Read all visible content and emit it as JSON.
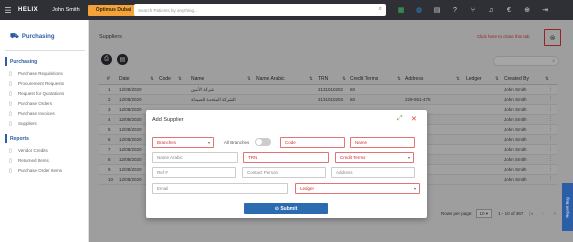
{
  "topbar": {
    "logo": "HELIX",
    "user_name": "John Smith",
    "company": "Optimus Dubai",
    "search_placeholder": "Search Patients by anything..."
  },
  "sidebar": {
    "title": "Purchasing",
    "items": [
      {
        "label": "Purchasing",
        "icon": "cart-icon",
        "section": true
      },
      {
        "label": "Purchase Requisitions",
        "icon": "doc-icon"
      },
      {
        "label": "Procurement Requests",
        "icon": "doc-icon"
      },
      {
        "label": "Request for Quotations",
        "icon": "doc-icon"
      },
      {
        "label": "Purchase Orders",
        "icon": "doc-icon"
      },
      {
        "label": "Purchase Invoices",
        "icon": "doc-icon"
      },
      {
        "label": "Suppliers",
        "icon": "doc-icon"
      },
      {
        "label": "Reports",
        "icon": "report-icon",
        "section": true
      },
      {
        "label": "Vendor Credits",
        "icon": "doc-icon"
      },
      {
        "label": "Returned Items",
        "icon": "doc-icon"
      },
      {
        "label": "Purchase Order Items",
        "icon": "doc-icon"
      }
    ]
  },
  "page": {
    "title": "Suppliers",
    "close_tip": "Click here to close this tab"
  },
  "table": {
    "columns": [
      "#",
      "Date",
      "Code",
      "Name",
      "Name Arabic",
      "TRN",
      "Credit Terms",
      "Address",
      "Ledger",
      "Created By"
    ],
    "rows": [
      {
        "n": "1",
        "date": "12/08/2020",
        "code": "",
        "name": "شركة الأمين",
        "name_ar": "",
        "trn": "2131010202",
        "terms": "60",
        "address": "",
        "ledger": "",
        "by": "John Smith"
      },
      {
        "n": "2",
        "date": "12/08/2020",
        "code": "",
        "name": "الشركة المتحدة للصيدلة",
        "name_ar": "",
        "trn": "2131010203",
        "terms": "60",
        "address": "229-551-475",
        "ledger": "",
        "by": "John Smith"
      },
      {
        "n": "3",
        "date": "12/08/2020",
        "code": "",
        "name": "",
        "name_ar": "",
        "trn": "",
        "terms": "",
        "address": "",
        "ledger": "",
        "by": "John Smith"
      },
      {
        "n": "4",
        "date": "12/08/2020",
        "code": "",
        "name": "",
        "name_ar": "",
        "trn": "",
        "terms": "",
        "address": "",
        "ledger": "",
        "by": "John Smith"
      },
      {
        "n": "5",
        "date": "12/08/2020",
        "code": "",
        "name": "",
        "name_ar": "",
        "trn": "",
        "terms": "",
        "address": "",
        "ledger": "",
        "by": "John Smith"
      },
      {
        "n": "6",
        "date": "12/08/2020",
        "code": "",
        "name": "",
        "name_ar": "",
        "trn": "",
        "terms": "",
        "address": "",
        "ledger": "",
        "by": "John Smith"
      },
      {
        "n": "7",
        "date": "12/08/2020",
        "code": "",
        "name": "",
        "name_ar": "",
        "trn": "",
        "terms": "",
        "address": "",
        "ledger": "",
        "by": "John Smith"
      },
      {
        "n": "8",
        "date": "12/08/2020",
        "code": "",
        "name": "",
        "name_ar": "",
        "trn": "",
        "terms": "",
        "address": "",
        "ledger": "",
        "by": "John Smith"
      },
      {
        "n": "9",
        "date": "12/08/2020",
        "code": "",
        "name": "",
        "name_ar": "",
        "trn": "",
        "terms": "",
        "address": "",
        "ledger": "",
        "by": "John Smith"
      },
      {
        "n": "10",
        "date": "12/08/2020",
        "code": "",
        "name": "",
        "name_ar": "",
        "trn": "",
        "terms": "",
        "address": "",
        "ledger": "",
        "by": "John Smith"
      }
    ]
  },
  "pager": {
    "rows_label": "Rows per page:",
    "rows_value": "10",
    "range": "1 - 10 of 367"
  },
  "feedback": "Report Bug",
  "modal": {
    "title": "Add Supplier",
    "branches_placeholder": "Branches",
    "all_branches_label": "All Branches",
    "code_placeholder": "Code",
    "name_placeholder": "Name",
    "name_arabic_placeholder": "Name Arabic",
    "trn_placeholder": "TRN",
    "credit_terms_placeholder": "Credit Terms",
    "ref_placeholder": "Ref #",
    "contact_placeholder": "Contact Person",
    "address_placeholder": "Address",
    "email_placeholder": "Email",
    "ledger_placeholder": "Ledger",
    "submit_label": "Submit"
  },
  "colors": {
    "topbar": "#2f3036",
    "accent": "#2b5ea6",
    "company_badge": "#f3a33a",
    "required": "#e53935",
    "submit": "#2b6cb0"
  }
}
